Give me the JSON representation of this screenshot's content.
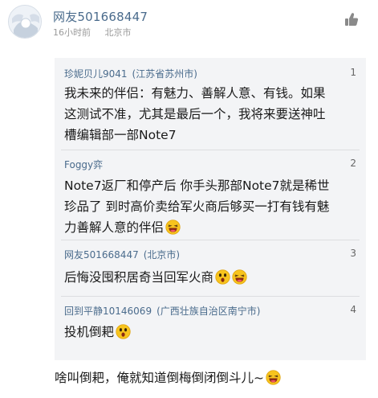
{
  "header": {
    "username": "网友501668447",
    "time": "16小时前",
    "location": "北京市"
  },
  "quotes": [
    {
      "name": "珍妮贝儿9041",
      "location": "(江苏省苏州市)",
      "number": "1",
      "lines": [
        "我未来的伴侣：有魅力、善解人意、有钱。如果",
        "这测试不准，尤其是最后一个，我将来要送神吐",
        "槽编辑部一部Note7"
      ]
    },
    {
      "name": "Foggy弈",
      "location": "",
      "number": "2",
      "lines": [
        "Note7返厂和停产后 你手头那部Note7就是稀世",
        "珍品了 到时高价卖给军火商后够买一打有钱有魅",
        "力善解人意的伴侣"
      ]
    },
    {
      "name": "网友501668447",
      "location": "(北京市)",
      "number": "3",
      "lines": [
        "后悔没囤积居奇当回军火商"
      ]
    },
    {
      "name": "回到平静10146069",
      "location": "(广西壮族自治区南宁市)",
      "number": "4",
      "lines": [
        "投机倒耙"
      ]
    }
  ],
  "main_comment": "啥叫倒耙，俺就知道倒梅倒闭倒斗儿~",
  "icons": {
    "avatar": "default-avatar-icon",
    "like": "thumbs-up-icon",
    "emoji_laugh": "laughing-emoji-icon",
    "emoji_surprise": "surprised-emoji-icon"
  },
  "colors": {
    "name": "#4a6b8c",
    "quote_bg": "#f3f4f6",
    "meta": "#9a9a9a"
  }
}
